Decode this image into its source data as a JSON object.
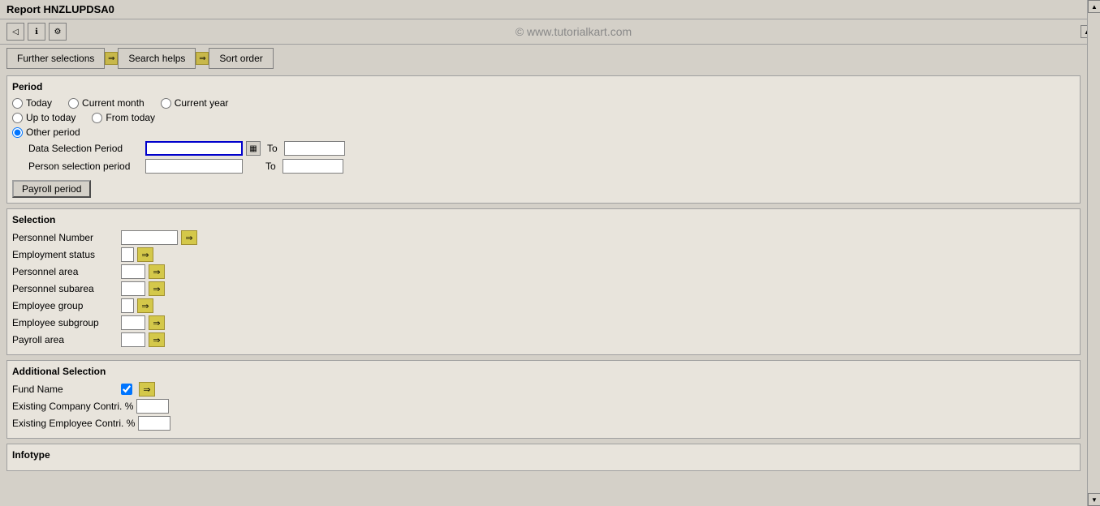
{
  "title": "Report HNZLUPDSA0",
  "watermark": "© www.tutorialkart.com",
  "toolbar": {
    "icons": [
      {
        "name": "back-icon",
        "symbol": "◁"
      },
      {
        "name": "info-icon",
        "symbol": "ℹ"
      },
      {
        "name": "settings-icon",
        "symbol": "⚙"
      }
    ]
  },
  "tabs": [
    {
      "label": "Further selections",
      "name": "further-selections-tab"
    },
    {
      "label": "Search helps",
      "name": "search-helps-tab"
    },
    {
      "label": "Sort order",
      "name": "sort-order-tab"
    }
  ],
  "period_section": {
    "title": "Period",
    "radios": [
      {
        "label": "Today",
        "name": "today",
        "checked": false
      },
      {
        "label": "Current month",
        "name": "current-month",
        "checked": false
      },
      {
        "label": "Current year",
        "name": "current-year",
        "checked": false
      },
      {
        "label": "Up to today",
        "name": "up-to-today",
        "checked": false
      },
      {
        "label": "From today",
        "name": "from-today",
        "checked": false
      },
      {
        "label": "Other period",
        "name": "other-period",
        "checked": true
      }
    ],
    "data_selection_label": "Data Selection Period",
    "person_selection_label": "Person selection period",
    "to_label": "To",
    "payroll_btn_label": "Payroll period",
    "cal_icon": "▦"
  },
  "selection_section": {
    "title": "Selection",
    "fields": [
      {
        "label": "Personnel Number",
        "name": "personnel-number",
        "size": "large"
      },
      {
        "label": "Employment status",
        "name": "employment-status",
        "size": "small"
      },
      {
        "label": "Personnel area",
        "name": "personnel-area",
        "size": "small"
      },
      {
        "label": "Personnel subarea",
        "name": "personnel-subarea",
        "size": "small"
      },
      {
        "label": "Employee group",
        "name": "employee-group",
        "size": "small"
      },
      {
        "label": "Employee subgroup",
        "name": "employee-subgroup",
        "size": "small"
      },
      {
        "label": "Payroll area",
        "name": "payroll-area",
        "size": "small"
      }
    ]
  },
  "additional_section": {
    "title": "Additional Selection",
    "fields": [
      {
        "label": "Fund Name",
        "name": "fund-name",
        "type": "checkbox",
        "checked": true
      },
      {
        "label": "Existing Company Contri. %",
        "name": "existing-company-contri",
        "size": "small"
      },
      {
        "label": "Existing Employee Contri. %",
        "name": "existing-employee-contri",
        "size": "small"
      }
    ]
  },
  "infotype_section": {
    "title": "Infotype"
  },
  "arrow_symbol": "⇒"
}
